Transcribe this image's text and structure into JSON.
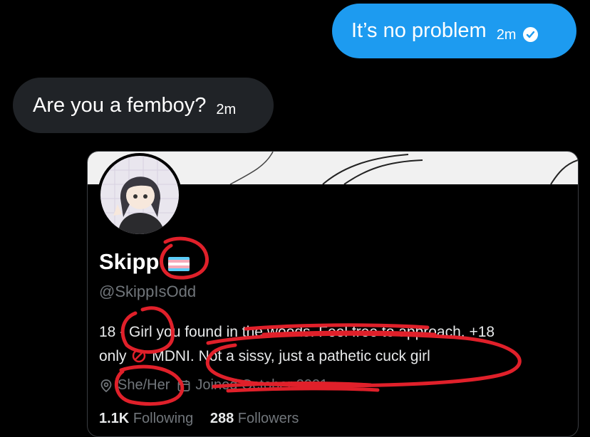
{
  "messages": {
    "sent": {
      "text": "It’s no problem",
      "time": "2m",
      "status_icon": "check-circle-icon"
    },
    "received": {
      "text": "Are you a femboy?",
      "time": "2m"
    }
  },
  "profile_card": {
    "display_name": "Skipp",
    "flag": "transgender-flag",
    "handle": "@SkippIsOdd",
    "bio_line1": "18 - Girl you found in the woods. Feel free to approach. +18",
    "bio_line2_start": "only",
    "bio_line2_mid": "MDNI.",
    "bio_line2_end": "Not a sissy, just a pathetic cuck girl",
    "location": "She/Her",
    "joined": "Joined October 2021",
    "following_count": "1.1K",
    "following_label": "Following",
    "followers_count": "288",
    "followers_label": "Followers"
  },
  "colors": {
    "accent": "#1d9bf0",
    "bubble_in": "#202327",
    "annotation": "#e0202a"
  }
}
